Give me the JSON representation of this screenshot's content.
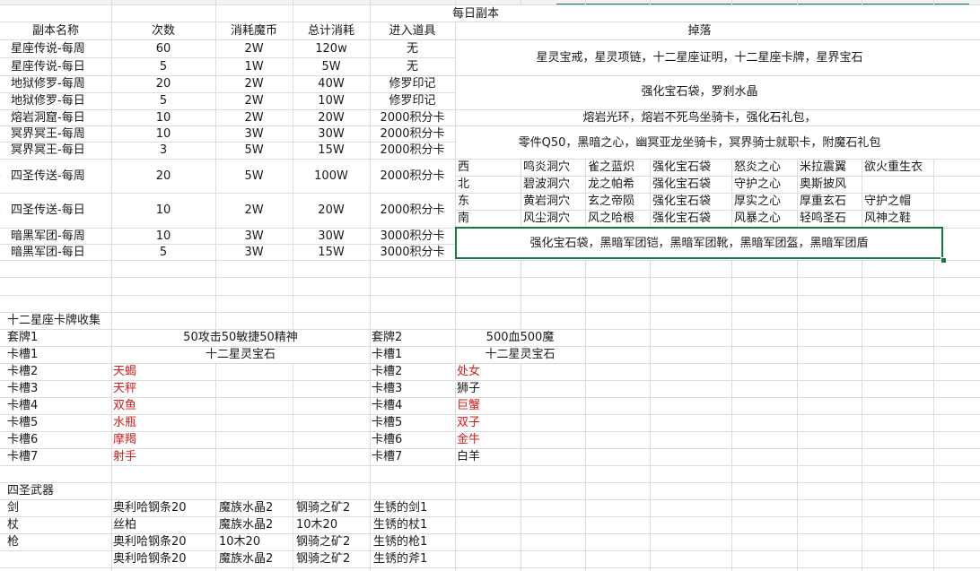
{
  "sheet": {
    "title": "每日副本",
    "headers": [
      "副本名称",
      "次数",
      "消耗魔币",
      "总计消耗",
      "进入道具",
      "掉落"
    ],
    "dungeons": [
      {
        "name": "星座传说-每周",
        "count": "60",
        "coins": "2W",
        "total": "120w",
        "item": "无"
      },
      {
        "name": "星座传说-每日",
        "count": "5",
        "coins": "1W",
        "total": "5W",
        "item": "无"
      },
      {
        "name": "地狱修罗-每周",
        "count": "20",
        "coins": "2W",
        "total": "40W",
        "item": "修罗印记"
      },
      {
        "name": "地狱修罗-每日",
        "count": "5",
        "coins": "2W",
        "total": "10W",
        "item": "修罗印记"
      },
      {
        "name": "熔岩洞窟-每日",
        "count": "10",
        "coins": "2W",
        "total": "20W",
        "item": "2000积分卡"
      },
      {
        "name": "冥界冥王-每周",
        "count": "10",
        "coins": "3W",
        "total": "30W",
        "item": "2000积分卡"
      },
      {
        "name": "冥界冥王-每日",
        "count": "3",
        "coins": "5W",
        "total": "15W",
        "item": "2000积分卡"
      },
      {
        "name": "四圣传送-每周",
        "count": "20",
        "coins": "5W",
        "total": "100W",
        "item": "2000积分卡"
      },
      {
        "name": "四圣传送-每日",
        "count": "10",
        "coins": "2W",
        "total": "20W",
        "item": "2000积分卡"
      },
      {
        "name": "暗黑军团-每周",
        "count": "10",
        "coins": "3W",
        "total": "30W",
        "item": "3000积分卡"
      },
      {
        "name": "暗黑军团-每日",
        "count": "5",
        "coins": "3W",
        "total": "15W",
        "item": "3000积分卡"
      }
    ],
    "drops": {
      "constellation": "星灵宝戒，星灵项链，十二星座证明，十二星座卡牌，星界宝石",
      "hell": "强化宝石袋，罗刹水晶",
      "lava": "熔岩光环，熔岩不死鸟坐骑卡，强化石礼包，",
      "underworld": "零件Q50，黑暗之心，幽冥亚龙坐骑卡，冥界骑士就职卡，附魔石礼包",
      "four_saints": [
        {
          "dir": "西",
          "cells": [
            "鸣炎洞穴",
            "雀之蓝炽",
            "强化宝石袋",
            "怒炎之心",
            "米拉震翼",
            "欲火重生衣"
          ]
        },
        {
          "dir": "北",
          "cells": [
            "碧波洞穴",
            "龙之帕希",
            "强化宝石袋",
            "守护之心",
            "奥斯披风",
            ""
          ]
        },
        {
          "dir": "东",
          "cells": [
            "黄岩洞穴",
            "玄之帝陨",
            "强化宝石袋",
            "厚实之心",
            "厚重玄石",
            "守护之帽"
          ]
        },
        {
          "dir": "南",
          "cells": [
            "风尘洞穴",
            "风之哈根",
            "强化宝石袋",
            "风暴之心",
            "轻鸣圣石",
            "风神之鞋"
          ]
        }
      ],
      "dark_legion": "强化宝石袋，黑暗军团铠，黑暗军团靴，黑暗军团盔，黑暗军团盾"
    },
    "zodiac": {
      "title": "十二星座卡牌收集",
      "set1": {
        "label": "套牌1",
        "bonus": "50攻击50敏捷50精神",
        "slots": [
          {
            "slot": "卡槽1",
            "value": "十二星灵宝石",
            "red": false
          },
          {
            "slot": "卡槽2",
            "value": "天蝎",
            "red": true
          },
          {
            "slot": "卡槽3",
            "value": "天秤",
            "red": true
          },
          {
            "slot": "卡槽4",
            "value": "双鱼",
            "red": true
          },
          {
            "slot": "卡槽5",
            "value": "水瓶",
            "red": true
          },
          {
            "slot": "卡槽6",
            "value": "摩羯",
            "red": true
          },
          {
            "slot": "卡槽7",
            "value": "射手",
            "red": true
          }
        ]
      },
      "set2": {
        "label": "套牌2",
        "bonus": "500血500魔",
        "slots": [
          {
            "slot": "卡槽1",
            "value": "十二星灵宝石",
            "red": false
          },
          {
            "slot": "卡槽2",
            "value": "处女",
            "red": true
          },
          {
            "slot": "卡槽3",
            "value": "狮子",
            "red": false
          },
          {
            "slot": "卡槽4",
            "value": "巨蟹",
            "red": true
          },
          {
            "slot": "卡槽5",
            "value": "双子",
            "red": true
          },
          {
            "slot": "卡槽6",
            "value": "金牛",
            "red": true
          },
          {
            "slot": "卡槽7",
            "value": "白羊",
            "red": false
          }
        ]
      }
    },
    "weapons": {
      "title": "四圣武器",
      "rows": [
        {
          "type": "剑",
          "m1": "奥利哈钢条20",
          "m2": "魔族水晶2",
          "m3": "钢骑之矿2",
          "m4": "生锈的剑1"
        },
        {
          "type": "杖",
          "m1": "丝柏",
          "m2": "魔族水晶2",
          "m3": "10木20",
          "m4": "生锈的杖1"
        },
        {
          "type": "枪",
          "m1": "奥利哈钢条20",
          "m2": "10木20",
          "m3": "钢骑之矿2",
          "m4": "生锈的枪1"
        },
        {
          "type": "",
          "m1": "奥利哈钢条20",
          "m2": "魔族水晶2",
          "m3": "钢骑之矿2",
          "m4": "生锈的斧1"
        }
      ]
    }
  }
}
